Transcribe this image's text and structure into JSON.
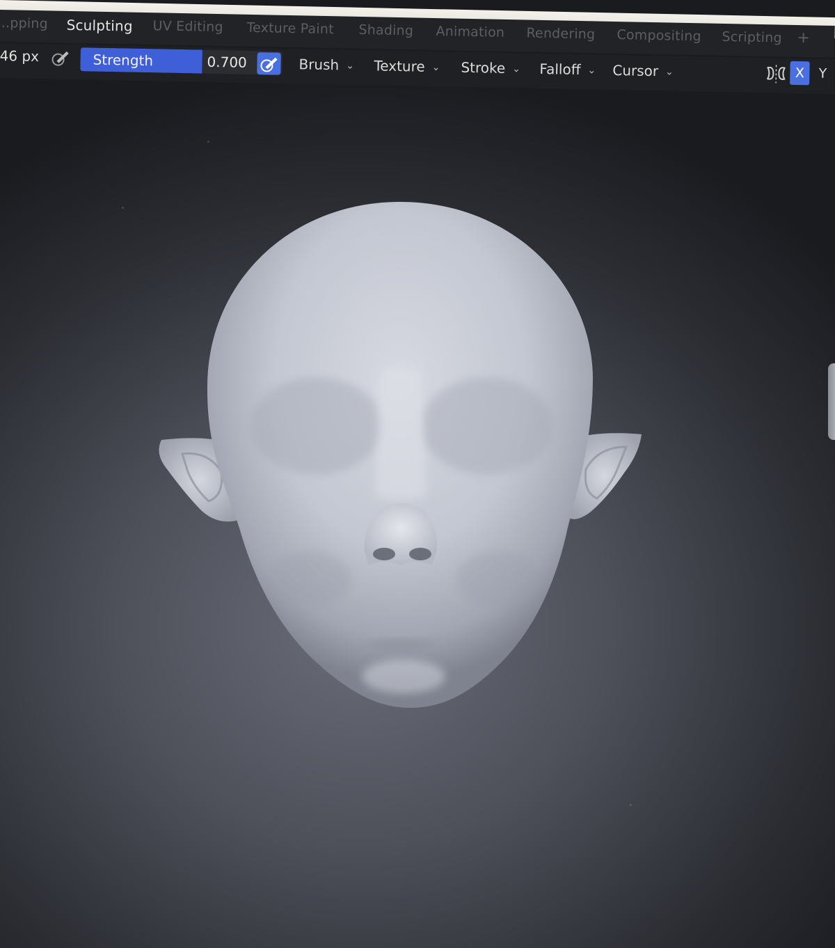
{
  "workspace_tabs": [
    {
      "label": "...pping",
      "active": false
    },
    {
      "label": "Sculpting",
      "active": true
    },
    {
      "label": "UV Editing",
      "active": false
    },
    {
      "label": "Texture Paint",
      "active": false
    },
    {
      "label": "Shading",
      "active": false
    },
    {
      "label": "Animation",
      "active": false
    },
    {
      "label": "Rendering",
      "active": false
    },
    {
      "label": "Compositing",
      "active": false
    },
    {
      "label": "Scripting",
      "active": false
    }
  ],
  "add_tab_label": "+",
  "tool_header": {
    "radius_value": "46 px",
    "strength_label": "Strength",
    "strength_value": "0.700",
    "strength_fraction": 0.7,
    "menus": [
      "Brush",
      "Texture",
      "Stroke",
      "Falloff",
      "Cursor"
    ],
    "symmetry_axis_x": "X",
    "symmetry_axis_y": "Y"
  },
  "colors": {
    "accent": "#3f5fd8",
    "header_bg": "#1f2023",
    "tab_inactive": "#5c5e63",
    "sculpt_material": "#c8ccd6"
  },
  "icons": {
    "pressure": "pen-pressure-icon",
    "symmetry": "mirror-symmetry-icon",
    "dropdown": "chevron-down-icon"
  }
}
